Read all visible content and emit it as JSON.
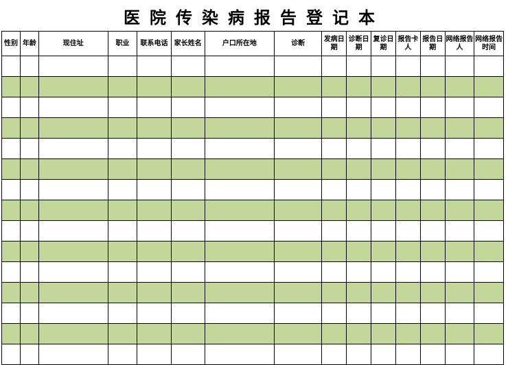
{
  "title": "医院传染病报告登记本",
  "columns": [
    "性别",
    "年龄",
    "现住址",
    "职业",
    "联系电话",
    "家长姓名",
    "户口所在地",
    "诊断",
    "发病日期",
    "诊断日期",
    "复诊日期",
    "报告卡人",
    "报告日期",
    "网络报告人",
    "网络报告时间"
  ],
  "row_count": 15,
  "colors": {
    "alt_row": "#c4d79b",
    "border": "#000000"
  },
  "chart_data": {
    "type": "table",
    "title": "医院传染病报告登记本",
    "columns": [
      "性别",
      "年龄",
      "现住址",
      "职业",
      "联系电话",
      "家长姓名",
      "户口所在地",
      "诊断",
      "发病日期",
      "诊断日期",
      "复诊日期",
      "报告卡人",
      "报告日期",
      "网络报告人",
      "网络报告时间"
    ],
    "rows": []
  }
}
